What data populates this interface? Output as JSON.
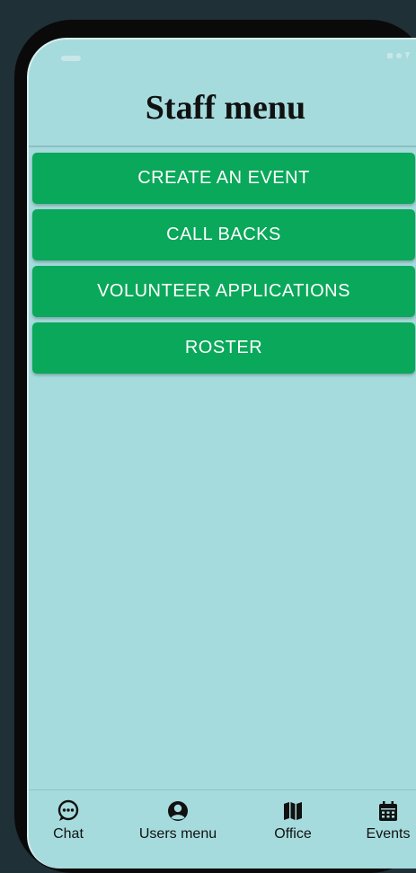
{
  "page": {
    "title": "Staff menu"
  },
  "menu": {
    "items": [
      {
        "label": "CREATE AN EVENT"
      },
      {
        "label": "CALL BACKS"
      },
      {
        "label": "VOLUNTEER APPLICATIONS"
      },
      {
        "label": "ROSTER"
      }
    ]
  },
  "bottom_nav": {
    "items": [
      {
        "label": "Chat",
        "icon": "chat-bubble-icon"
      },
      {
        "label": "Users menu",
        "icon": "user-circle-icon"
      },
      {
        "label": "Office",
        "icon": "map-icon"
      },
      {
        "label": "Events",
        "icon": "calendar-icon"
      }
    ]
  },
  "colors": {
    "screen_background": "#a6dbdd",
    "button_background": "#0aa85a",
    "button_text": "#ffffff",
    "frame": "#0a0a0a"
  }
}
